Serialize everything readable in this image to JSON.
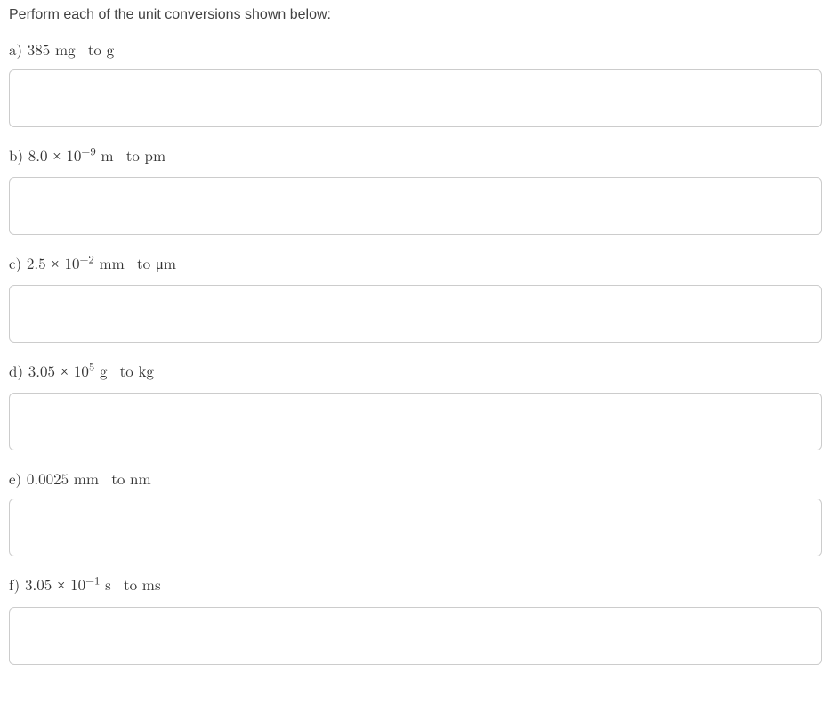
{
  "instruction": "Perform each of the unit conversions shown below:",
  "questions": [
    {
      "letter": "a)",
      "coeff": "385",
      "unit_from": "mg",
      "to": "to",
      "unit_to": "g",
      "exp": null
    },
    {
      "letter": "b)",
      "coeff": "8.0",
      "times": "×",
      "base": "10",
      "exp": "−9",
      "unit_from": "m",
      "to": "to",
      "unit_to": "pm"
    },
    {
      "letter": "c)",
      "coeff": "2.5",
      "times": "×",
      "base": "10",
      "exp": "−2",
      "unit_from": "mm",
      "to": "to",
      "unit_to": "μm"
    },
    {
      "letter": "d)",
      "coeff": "3.05",
      "times": "×",
      "base": "10",
      "exp": "5",
      "unit_from": "g",
      "to": "to",
      "unit_to": "kg"
    },
    {
      "letter": "e)",
      "coeff": "0.0025",
      "unit_from": "mm",
      "to": "to",
      "unit_to": "nm",
      "exp": null
    },
    {
      "letter": "f)",
      "coeff": "3.05",
      "times": "×",
      "base": "10",
      "exp": "−1",
      "unit_from": "s",
      "to": "to",
      "unit_to": "ms"
    }
  ]
}
